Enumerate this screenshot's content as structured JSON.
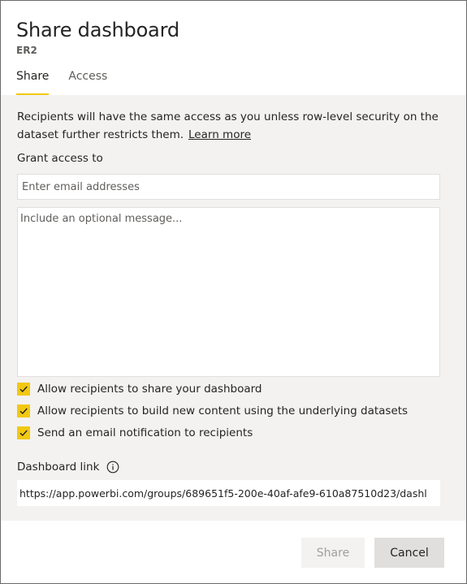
{
  "dialog": {
    "title": "Share dashboard",
    "subtitle": "ER2"
  },
  "tabs": [
    {
      "label": "Share",
      "active": true
    },
    {
      "label": "Access",
      "active": false
    }
  ],
  "info": {
    "text": "Recipients will have the same access as you unless row-level security on the dataset further restricts them.",
    "learn_more": "Learn more"
  },
  "grant": {
    "label": "Grant access to",
    "email_placeholder": "Enter email addresses",
    "message_placeholder": "Include an optional message..."
  },
  "options": [
    {
      "label": "Allow recipients to share your dashboard",
      "checked": true
    },
    {
      "label": "Allow recipients to build new content using the underlying datasets",
      "checked": true
    },
    {
      "label": "Send an email notification to recipients",
      "checked": true
    }
  ],
  "link": {
    "label": "Dashboard link",
    "icon": "info-icon",
    "value": "https://app.powerbi.com/groups/689651f5-200e-40af-afe9-610a87510d23/dashl"
  },
  "footer": {
    "share_label": "Share",
    "cancel_label": "Cancel"
  },
  "colors": {
    "accent": "#f2c811",
    "panel_background": "#f3f2f1"
  }
}
